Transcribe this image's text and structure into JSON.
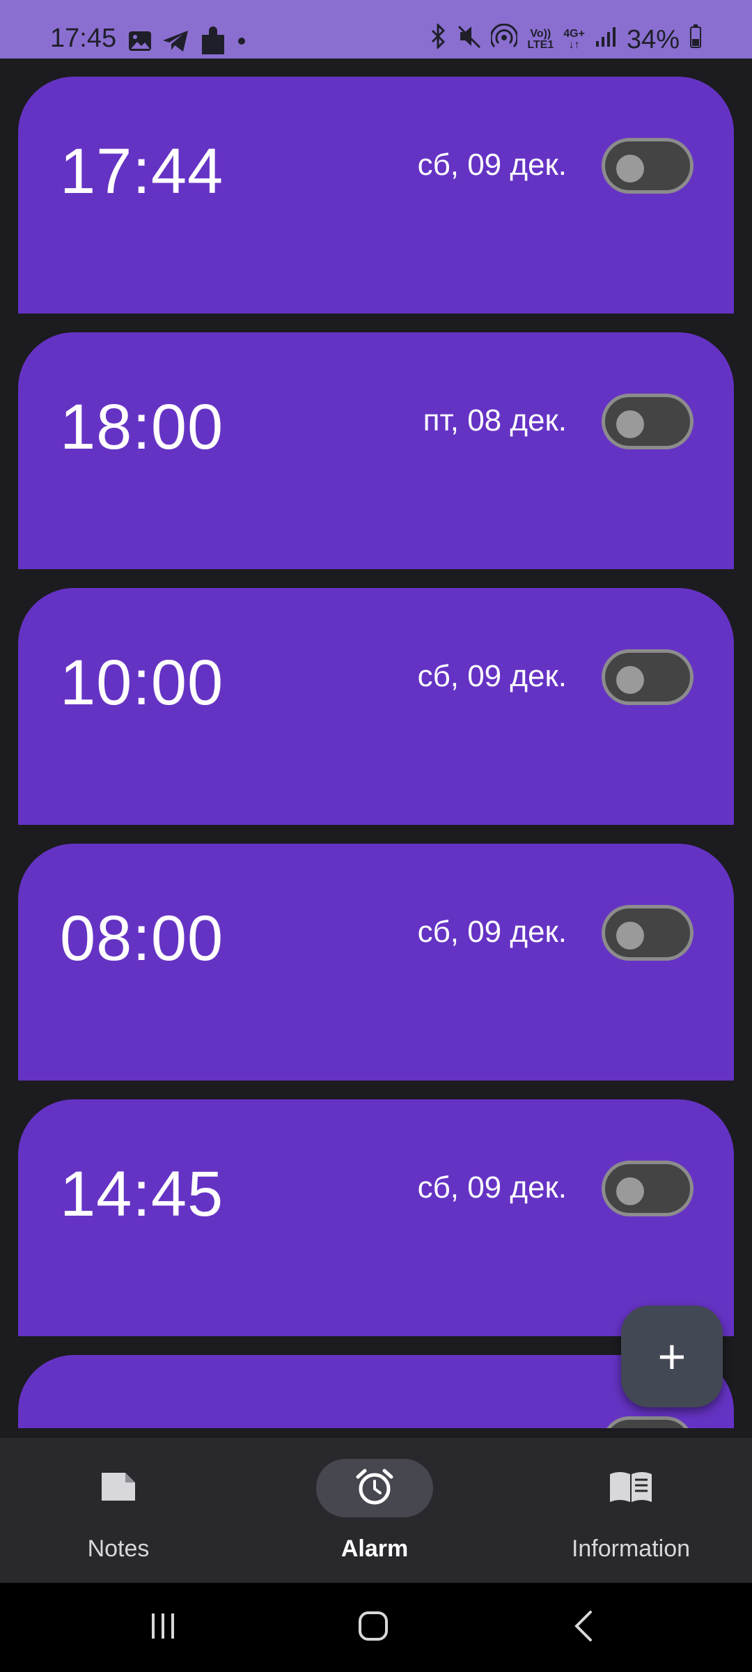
{
  "status_bar": {
    "time": "17:45",
    "battery": "34%",
    "left_icons": [
      "image-icon",
      "telegram-icon",
      "puzzle-icon",
      "dot-icon"
    ],
    "right_icons": [
      "bluetooth-icon",
      "mute-icon",
      "hotspot-icon",
      "volte-icon",
      "4g-icon",
      "signal-icon",
      "battery-icon"
    ],
    "volte_top": "Vo))",
    "volte_bottom": "LTE1",
    "net_type": "4G+",
    "colors": {
      "background": "#8a6fd0"
    }
  },
  "alarms": [
    {
      "time": "17:44",
      "date": "сб, 09 дек.",
      "enabled": false
    },
    {
      "time": "18:00",
      "date": "пт, 08 дек.",
      "enabled": false
    },
    {
      "time": "10:00",
      "date": "сб, 09 дек.",
      "enabled": false
    },
    {
      "time": "08:00",
      "date": "сб, 09 дек.",
      "enabled": false
    },
    {
      "time": "14:45",
      "date": "сб, 09 дек.",
      "enabled": false
    }
  ],
  "fab": {
    "symbol": "+",
    "icon": "plus-icon"
  },
  "bottom_nav": {
    "items": [
      {
        "label": "Notes",
        "icon": "note-icon",
        "active": false
      },
      {
        "label": "Alarm",
        "icon": "alarm-clock-icon",
        "active": true
      },
      {
        "label": "Information",
        "icon": "book-icon",
        "active": false
      }
    ]
  },
  "system_nav": {
    "buttons": [
      "recents-icon",
      "home-icon",
      "back-icon"
    ]
  },
  "colors": {
    "card": "#6533c4",
    "background": "#1c1b1f",
    "nav_background": "#29282c",
    "fab": "#434855"
  }
}
